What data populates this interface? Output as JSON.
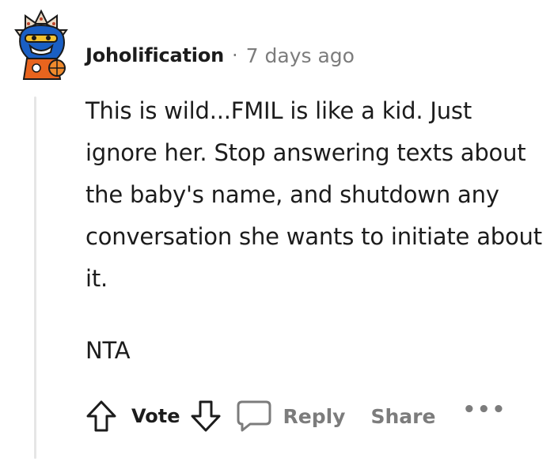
{
  "comment": {
    "username": "Joholification",
    "separator": "·",
    "timestamp": "7 days ago",
    "paragraphs": [
      "This is wild...FMIL is like a kid. Just ignore her. Stop answering texts about the baby's name, and shutdown any conversation she wants to initiate about it.",
      "NTA"
    ]
  },
  "actions": {
    "upvote_icon": "arrow-up-icon",
    "vote_label": "Vote",
    "downvote_icon": "arrow-down-icon",
    "reply_icon": "speech-bubble-icon",
    "reply_label": "Reply",
    "share_label": "Share",
    "more_label": "•••"
  },
  "colors": {
    "text": "#1c1c1c",
    "muted": "#7c7c7c",
    "thread_line": "#e6e6e6",
    "avatar_blue": "#1a5fc4",
    "avatar_orange": "#e8641e"
  }
}
